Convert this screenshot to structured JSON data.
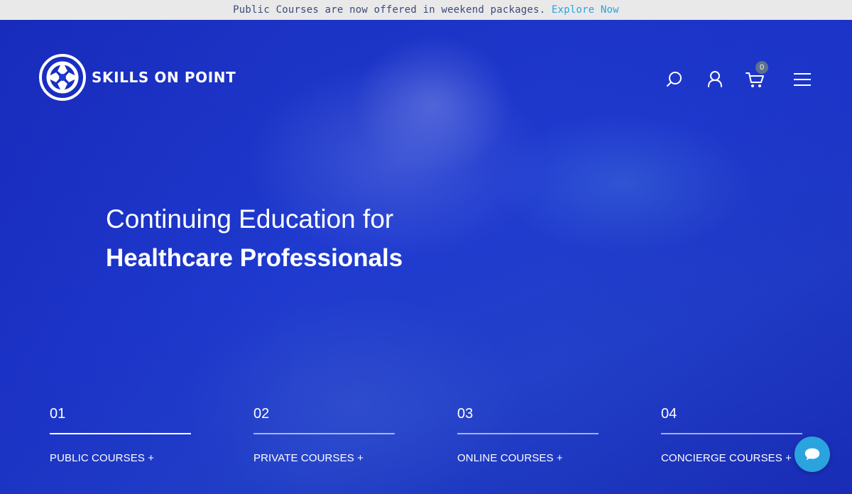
{
  "announcement": {
    "text": "Public Courses are now offered in weekend packages.",
    "link": "Explore Now"
  },
  "brand": {
    "name": "SKILLS ON POINT"
  },
  "header": {
    "icons": [
      "search-icon",
      "user-icon",
      "cart-icon",
      "menu-icon"
    ],
    "cart_count": "0"
  },
  "hero": {
    "line1": "Continuing Education for",
    "line2": "Healthcare Professionals"
  },
  "courses": [
    {
      "num": "01",
      "label": "PUBLIC COURSES +"
    },
    {
      "num": "02",
      "label": "PRIVATE COURSES +"
    },
    {
      "num": "03",
      "label": "ONLINE COURSES +"
    },
    {
      "num": "04",
      "label": "CONCIERGE COURSES +"
    }
  ],
  "colors": {
    "accent": "#2aa3df",
    "hero_blue": "#1f3acf",
    "announce_bg": "#e9e9e9"
  }
}
